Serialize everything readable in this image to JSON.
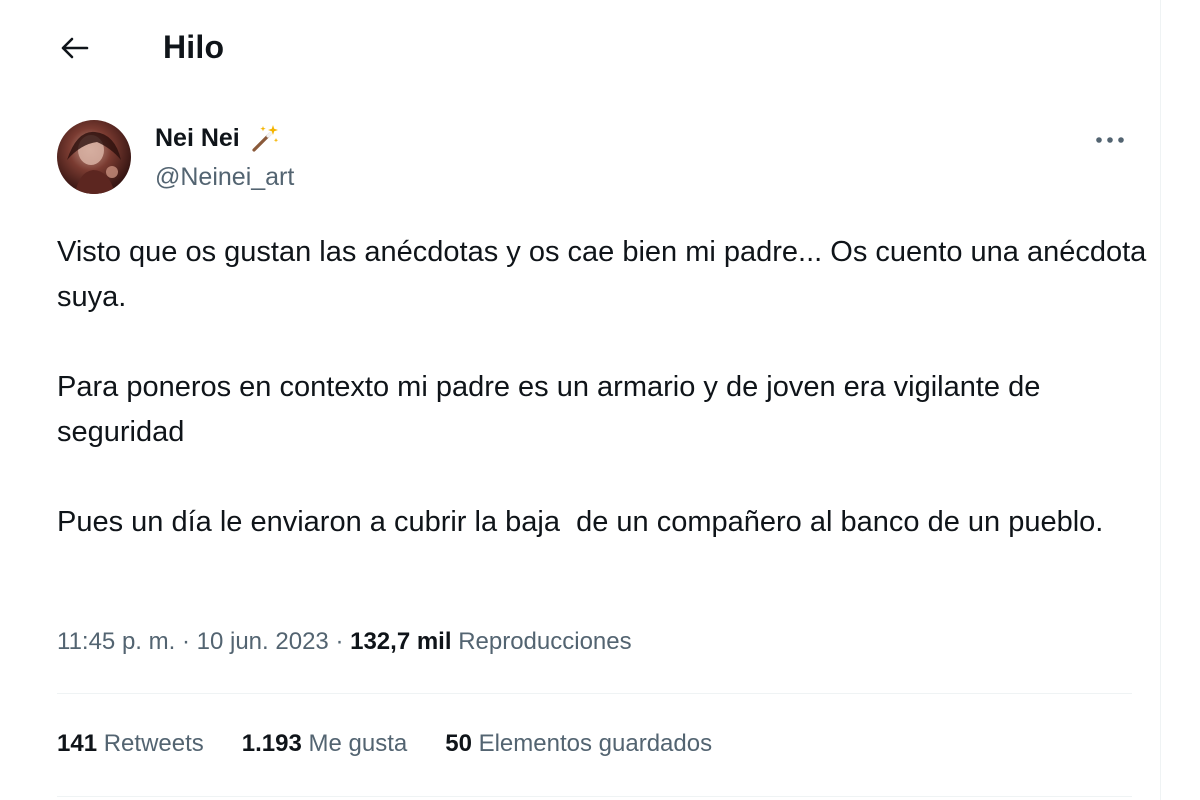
{
  "header": {
    "back_icon": "arrow-left-icon",
    "title": "Hilo"
  },
  "author": {
    "name": "Nei Nei",
    "badge_icon": "magic-wand-icon",
    "handle": "@Neinei_art"
  },
  "more_icon": "more-horizontal-icon",
  "tweet": {
    "paragraphs": [
      "Visto que os gustan las anécdotas y os cae bien mi padre... Os cuento una anécdota suya.",
      "Para poneros en contexto mi padre es un armario y de joven era vigilante de seguridad",
      "Pues un día le enviaron a cubrir la baja  de un compañero al banco de un pueblo."
    ]
  },
  "meta": {
    "time": "11:45 p. m.",
    "date": "10 jun. 2023",
    "views_count": "132,7 mil",
    "views_label": "Reproducciones"
  },
  "stats": {
    "retweets_count": "141",
    "retweets_label": "Retweets",
    "likes_count": "1.193",
    "likes_label": "Me gusta",
    "bookmarks_count": "50",
    "bookmarks_label": "Elementos guardados"
  },
  "colors": {
    "text_primary": "#0f1419",
    "text_secondary": "#536471",
    "divider": "#eff3f4"
  }
}
